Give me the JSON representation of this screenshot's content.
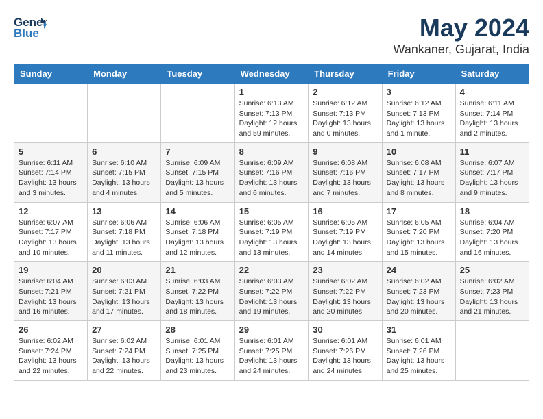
{
  "header": {
    "logo": {
      "general": "General",
      "blue": "Blue",
      "icon": "▶"
    },
    "title": "May 2024",
    "location": "Wankaner, Gujarat, India"
  },
  "weekdays": [
    "Sunday",
    "Monday",
    "Tuesday",
    "Wednesday",
    "Thursday",
    "Friday",
    "Saturday"
  ],
  "weeks": [
    [
      {
        "day": "",
        "sunrise": "",
        "sunset": "",
        "daylight": ""
      },
      {
        "day": "",
        "sunrise": "",
        "sunset": "",
        "daylight": ""
      },
      {
        "day": "",
        "sunrise": "",
        "sunset": "",
        "daylight": ""
      },
      {
        "day": "1",
        "sunrise": "Sunrise: 6:13 AM",
        "sunset": "Sunset: 7:13 PM",
        "daylight": "Daylight: 12 hours and 59 minutes."
      },
      {
        "day": "2",
        "sunrise": "Sunrise: 6:12 AM",
        "sunset": "Sunset: 7:13 PM",
        "daylight": "Daylight: 13 hours and 0 minutes."
      },
      {
        "day": "3",
        "sunrise": "Sunrise: 6:12 AM",
        "sunset": "Sunset: 7:13 PM",
        "daylight": "Daylight: 13 hours and 1 minute."
      },
      {
        "day": "4",
        "sunrise": "Sunrise: 6:11 AM",
        "sunset": "Sunset: 7:14 PM",
        "daylight": "Daylight: 13 hours and 2 minutes."
      }
    ],
    [
      {
        "day": "5",
        "sunrise": "Sunrise: 6:11 AM",
        "sunset": "Sunset: 7:14 PM",
        "daylight": "Daylight: 13 hours and 3 minutes."
      },
      {
        "day": "6",
        "sunrise": "Sunrise: 6:10 AM",
        "sunset": "Sunset: 7:15 PM",
        "daylight": "Daylight: 13 hours and 4 minutes."
      },
      {
        "day": "7",
        "sunrise": "Sunrise: 6:09 AM",
        "sunset": "Sunset: 7:15 PM",
        "daylight": "Daylight: 13 hours and 5 minutes."
      },
      {
        "day": "8",
        "sunrise": "Sunrise: 6:09 AM",
        "sunset": "Sunset: 7:16 PM",
        "daylight": "Daylight: 13 hours and 6 minutes."
      },
      {
        "day": "9",
        "sunrise": "Sunrise: 6:08 AM",
        "sunset": "Sunset: 7:16 PM",
        "daylight": "Daylight: 13 hours and 7 minutes."
      },
      {
        "day": "10",
        "sunrise": "Sunrise: 6:08 AM",
        "sunset": "Sunset: 7:17 PM",
        "daylight": "Daylight: 13 hours and 8 minutes."
      },
      {
        "day": "11",
        "sunrise": "Sunrise: 6:07 AM",
        "sunset": "Sunset: 7:17 PM",
        "daylight": "Daylight: 13 hours and 9 minutes."
      }
    ],
    [
      {
        "day": "12",
        "sunrise": "Sunrise: 6:07 AM",
        "sunset": "Sunset: 7:17 PM",
        "daylight": "Daylight: 13 hours and 10 minutes."
      },
      {
        "day": "13",
        "sunrise": "Sunrise: 6:06 AM",
        "sunset": "Sunset: 7:18 PM",
        "daylight": "Daylight: 13 hours and 11 minutes."
      },
      {
        "day": "14",
        "sunrise": "Sunrise: 6:06 AM",
        "sunset": "Sunset: 7:18 PM",
        "daylight": "Daylight: 13 hours and 12 minutes."
      },
      {
        "day": "15",
        "sunrise": "Sunrise: 6:05 AM",
        "sunset": "Sunset: 7:19 PM",
        "daylight": "Daylight: 13 hours and 13 minutes."
      },
      {
        "day": "16",
        "sunrise": "Sunrise: 6:05 AM",
        "sunset": "Sunset: 7:19 PM",
        "daylight": "Daylight: 13 hours and 14 minutes."
      },
      {
        "day": "17",
        "sunrise": "Sunrise: 6:05 AM",
        "sunset": "Sunset: 7:20 PM",
        "daylight": "Daylight: 13 hours and 15 minutes."
      },
      {
        "day": "18",
        "sunrise": "Sunrise: 6:04 AM",
        "sunset": "Sunset: 7:20 PM",
        "daylight": "Daylight: 13 hours and 16 minutes."
      }
    ],
    [
      {
        "day": "19",
        "sunrise": "Sunrise: 6:04 AM",
        "sunset": "Sunset: 7:21 PM",
        "daylight": "Daylight: 13 hours and 16 minutes."
      },
      {
        "day": "20",
        "sunrise": "Sunrise: 6:03 AM",
        "sunset": "Sunset: 7:21 PM",
        "daylight": "Daylight: 13 hours and 17 minutes."
      },
      {
        "day": "21",
        "sunrise": "Sunrise: 6:03 AM",
        "sunset": "Sunset: 7:22 PM",
        "daylight": "Daylight: 13 hours and 18 minutes."
      },
      {
        "day": "22",
        "sunrise": "Sunrise: 6:03 AM",
        "sunset": "Sunset: 7:22 PM",
        "daylight": "Daylight: 13 hours and 19 minutes."
      },
      {
        "day": "23",
        "sunrise": "Sunrise: 6:02 AM",
        "sunset": "Sunset: 7:22 PM",
        "daylight": "Daylight: 13 hours and 20 minutes."
      },
      {
        "day": "24",
        "sunrise": "Sunrise: 6:02 AM",
        "sunset": "Sunset: 7:23 PM",
        "daylight": "Daylight: 13 hours and 20 minutes."
      },
      {
        "day": "25",
        "sunrise": "Sunrise: 6:02 AM",
        "sunset": "Sunset: 7:23 PM",
        "daylight": "Daylight: 13 hours and 21 minutes."
      }
    ],
    [
      {
        "day": "26",
        "sunrise": "Sunrise: 6:02 AM",
        "sunset": "Sunset: 7:24 PM",
        "daylight": "Daylight: 13 hours and 22 minutes."
      },
      {
        "day": "27",
        "sunrise": "Sunrise: 6:02 AM",
        "sunset": "Sunset: 7:24 PM",
        "daylight": "Daylight: 13 hours and 22 minutes."
      },
      {
        "day": "28",
        "sunrise": "Sunrise: 6:01 AM",
        "sunset": "Sunset: 7:25 PM",
        "daylight": "Daylight: 13 hours and 23 minutes."
      },
      {
        "day": "29",
        "sunrise": "Sunrise: 6:01 AM",
        "sunset": "Sunset: 7:25 PM",
        "daylight": "Daylight: 13 hours and 24 minutes."
      },
      {
        "day": "30",
        "sunrise": "Sunrise: 6:01 AM",
        "sunset": "Sunset: 7:26 PM",
        "daylight": "Daylight: 13 hours and 24 minutes."
      },
      {
        "day": "31",
        "sunrise": "Sunrise: 6:01 AM",
        "sunset": "Sunset: 7:26 PM",
        "daylight": "Daylight: 13 hours and 25 minutes."
      },
      {
        "day": "",
        "sunrise": "",
        "sunset": "",
        "daylight": ""
      }
    ]
  ]
}
